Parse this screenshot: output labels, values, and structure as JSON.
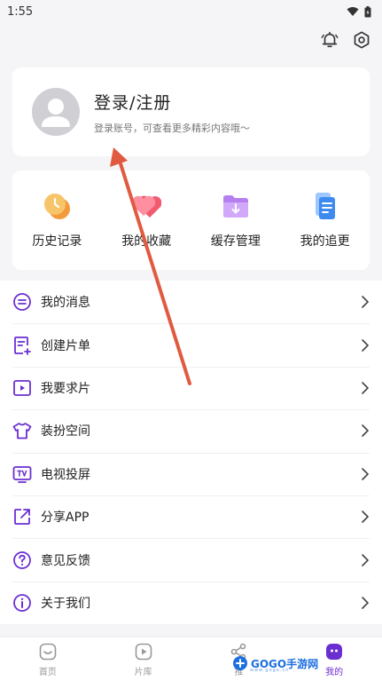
{
  "status_bar": {
    "time": "1:55"
  },
  "colors": {
    "accent": "#6b2fd1",
    "annotation_arrow": "#e05a40"
  },
  "login": {
    "title": "登录/注册",
    "subtitle": "登录账号，可查看更多精彩内容哦～"
  },
  "quick_actions": [
    {
      "label": "历史记录",
      "icon": "history-clock-icon"
    },
    {
      "label": "我的收藏",
      "icon": "heart-favorites-icon"
    },
    {
      "label": "缓存管理",
      "icon": "download-folder-icon"
    },
    {
      "label": "我的追更",
      "icon": "follow-updates-icon"
    }
  ],
  "menu": [
    {
      "label": "我的消息",
      "icon": "message-icon"
    },
    {
      "label": "创建片单",
      "icon": "create-list-icon"
    },
    {
      "label": "我要求片",
      "icon": "request-video-icon"
    },
    {
      "label": "装扮空间",
      "icon": "shirt-icon"
    },
    {
      "label": "电视投屏",
      "icon": "tv-cast-icon"
    },
    {
      "label": "分享APP",
      "icon": "share-icon"
    },
    {
      "label": "意见反馈",
      "icon": "feedback-question-icon"
    },
    {
      "label": "关于我们",
      "icon": "info-icon"
    }
  ],
  "tabs": [
    {
      "label": "首页",
      "icon": "home-icon"
    },
    {
      "label": "片库",
      "icon": "library-icon"
    },
    {
      "label": "推",
      "icon": "discover-icon"
    },
    {
      "label": "我的",
      "icon": "profile-icon",
      "active": true
    }
  ],
  "watermark": {
    "text": "GOGO手游网"
  }
}
